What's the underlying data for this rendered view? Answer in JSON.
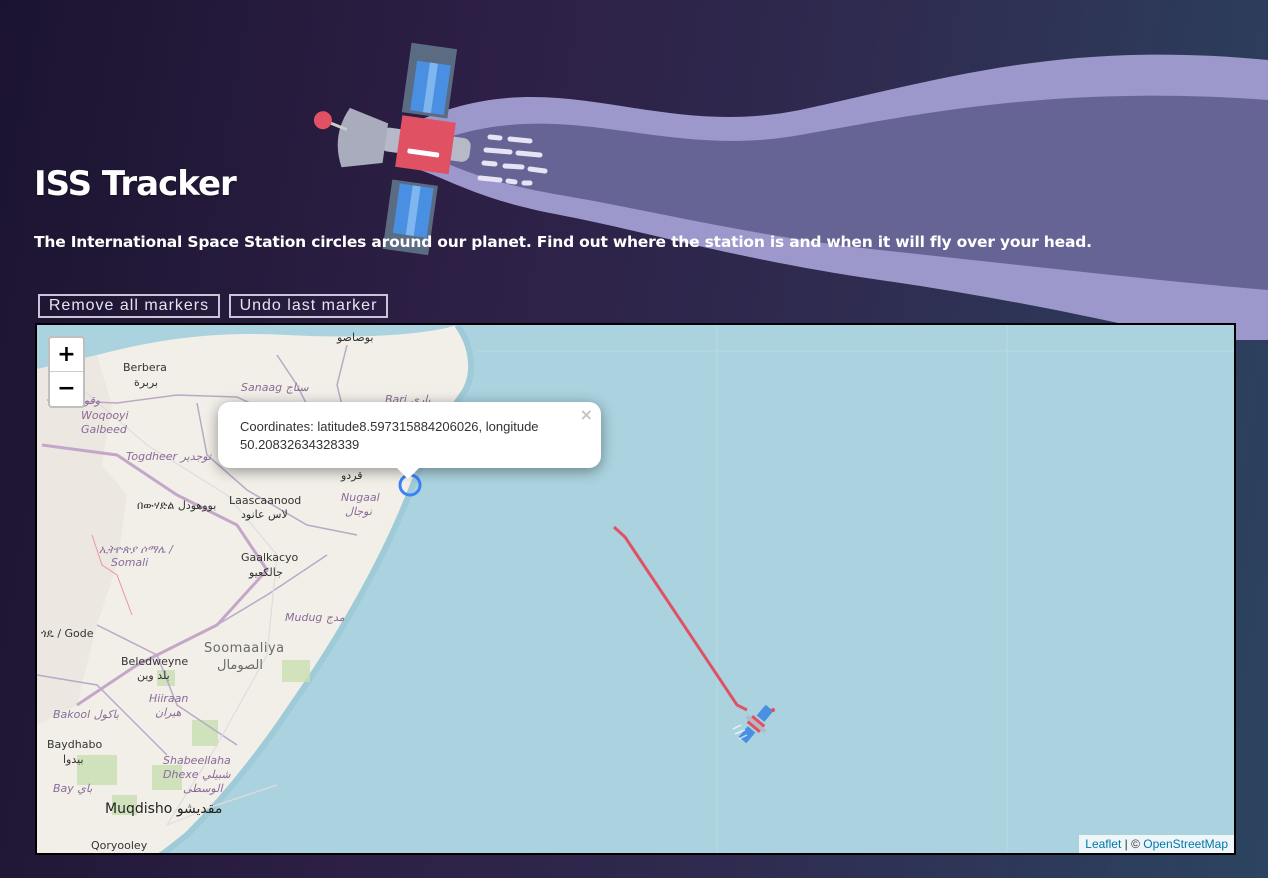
{
  "header": {
    "title": "ISS Tracker",
    "subtitle": "The International Space Station circles around our planet. Find out where the station is and when it will fly over your head."
  },
  "controls": {
    "remove_all_label": "Remove all markers",
    "undo_last_label": "Undo last marker"
  },
  "map": {
    "zoom_in_label": "+",
    "zoom_out_label": "−",
    "popup": {
      "text": "Coordinates: latitude8.597315884206026, longitude 50.20832634328339",
      "close_label": "×"
    },
    "attribution": {
      "leaflet_label": "Leaflet",
      "separator": " | © ",
      "osm_label": "OpenStreetMap"
    },
    "labels": {
      "bosaso": "بوصاصو",
      "berbera": "Berbera",
      "berbera_ar": "بربرة",
      "sanaag": "Sanaag سناج",
      "woqooyi_ar": "وقويي غال",
      "woqooyi": "Woqooyi",
      "galbeed": "Galbeed",
      "bari": "Bari باري",
      "togdheer": "Togdheer توجدير",
      "qardho": "قردو",
      "nugaal": "Nugaal",
      "nugaal_ar": "نوجال",
      "laascaanood": "Laascaanood",
      "laascaanood_ar": "لاس عانود",
      "bohodle": "በውሃድል بووهودل",
      "somali_region_am": "ኢትዮጵያ ሶማሌ /",
      "somali": "Somali",
      "gaalkacyo": "Gaalkacyo",
      "gaalkacyo_ar": "جالكعيو",
      "mudug": "Mudug مدج",
      "gode": "ጎዴ / Gode",
      "soomaaliya": "Soomaaliya",
      "soomaaliya_ar": "الصومال",
      "beledweyne": "Beledweyne",
      "beledweyne_ar": "بلد وين",
      "hiiraan": "Hiiraan",
      "hiiraan_ar": "هيران",
      "bakool": "Bakool باكول",
      "baydhabo": "Baydhabo",
      "baydhabo_ar": "بيدوا",
      "shabeellaha": "Shabeellaha",
      "dhexe": "Dhexe شبيلي",
      "dhexe_ar": "الوسطى",
      "bay": "Bay باي",
      "muqdisho": "Muqdisho مقديشو",
      "qoryooley": "Qoryooley"
    }
  },
  "colors": {
    "track_line": "#e05263",
    "marker_ring": "#3b82f6",
    "water": "#aad3df",
    "land": "#f2efe9"
  }
}
